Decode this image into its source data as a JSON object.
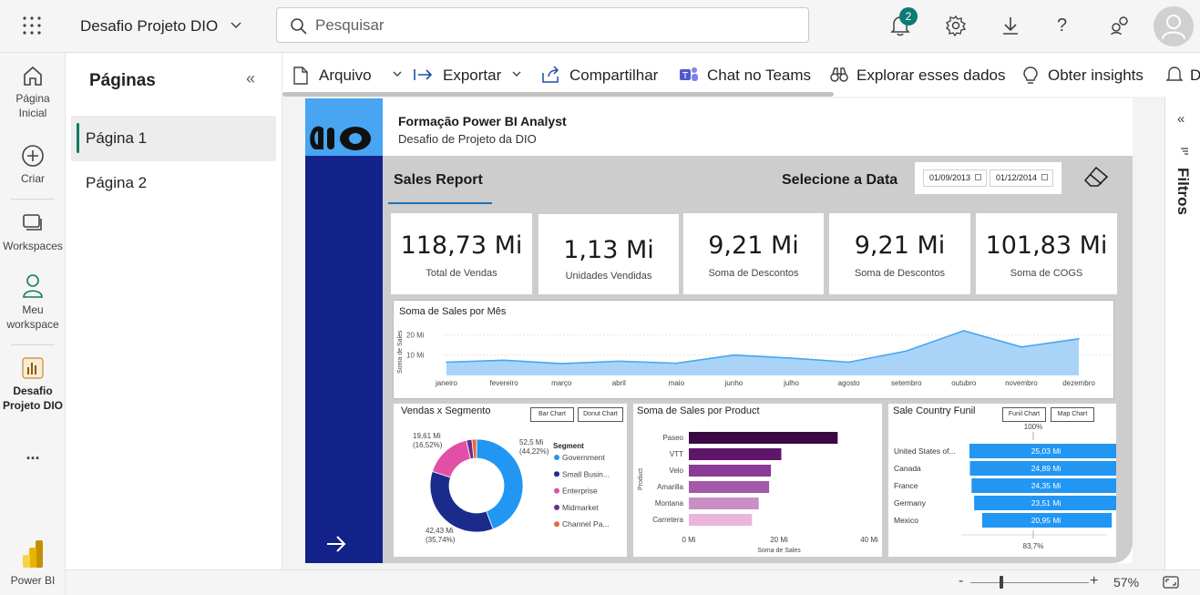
{
  "topbar": {
    "workspace_title": "Desafio Projeto DIO",
    "search_placeholder": "Pesquisar",
    "notification_count": "2"
  },
  "rail": {
    "items": [
      {
        "label": "Página Inicial"
      },
      {
        "label": "Criar"
      },
      {
        "label": "Workspaces"
      },
      {
        "label": "Meu workspace"
      },
      {
        "label": "Desafio Projeto DIO"
      },
      {
        "label": "..."
      }
    ],
    "brand": "Power BI"
  },
  "pages_pane": {
    "title": "Páginas",
    "pages": [
      "Página 1",
      "Página 2"
    ],
    "active": "Página 1"
  },
  "commands": {
    "arquivo": "Arquivo",
    "exportar": "Exportar",
    "compartilhar": "Compartilhar",
    "teams": "Chat no Teams",
    "explorar": "Explorar esses dados",
    "insights": "Obter insights",
    "cut": "D"
  },
  "report": {
    "title": "Formação Power BI Analyst",
    "subtitle": "Desafio de Projeto da DIO",
    "section": "Sales Report",
    "date_label": "Selecione a Data",
    "date_start": "01/09/2013",
    "date_end": "01/12/2014",
    "kpis": [
      {
        "value": "118,73 Mi",
        "label": "Total de Vendas"
      },
      {
        "value": "1,13 Mi",
        "label": "Unidades Vendidas"
      },
      {
        "value": "9,21 Mi",
        "label": "Soma de Descontos"
      },
      {
        "value": "9,21 Mi",
        "label": "Soma de Descontos"
      },
      {
        "value": "101,83 Mi",
        "label": "Soma de COGS"
      }
    ],
    "visual_titles": {
      "line": "Soma de Sales por Mês",
      "donut": "Vendas x Segmento",
      "bar": "Soma de Sales por Product",
      "funnel": "Sale Country Funil"
    },
    "buttons": {
      "bar_chart": "Bar Chart",
      "donut_chart": "Donut Chart",
      "funil_chart": "Funil Chart",
      "map_chart": "Map Chart"
    }
  },
  "chart_data": [
    {
      "type": "area",
      "title": "Soma de Sales por Mês",
      "ylabel": "Soma de Sales",
      "xlabel": "",
      "categories": [
        "janeiro",
        "fevereiro",
        "março",
        "abril",
        "maio",
        "junho",
        "julho",
        "agosto",
        "setembro",
        "outubro",
        "novembro",
        "dezembro"
      ],
      "values": [
        6.5,
        7.5,
        5.8,
        7.0,
        6.0,
        10.0,
        8.5,
        6.5,
        12.0,
        22.0,
        14.0,
        18.0
      ],
      "yticks": [
        "10 Mi",
        "20 Mi"
      ],
      "ytick_values": [
        10,
        20
      ],
      "ylim": [
        0,
        26
      ],
      "color": "#47a5f2"
    },
    {
      "type": "pie",
      "title": "Vendas x Segmento",
      "legend_title": "Segment",
      "categories": [
        "Government",
        "Small Busin...",
        "Enterprise",
        "Midmarket",
        "Channel Pa..."
      ],
      "values": [
        52.5,
        42.43,
        19.61,
        2.3,
        1.9
      ],
      "data_labels": [
        {
          "value": "52,5 Mi",
          "pct": "(44,22%)"
        },
        {
          "value": "42,43 Mi",
          "pct": "(35,74%)"
        },
        {
          "value": "19,61 Mi",
          "pct": "(16,52%)"
        }
      ],
      "colors": [
        "#2196f3",
        "#1a2b8c",
        "#e34fa6",
        "#6e2b8f",
        "#e86a3a"
      ],
      "legend_position": "right"
    },
    {
      "type": "bar",
      "title": "Soma de Sales por Product",
      "xlabel": "Soma de Sales",
      "ylabel": "Product",
      "categories": [
        "Paseo",
        "VTT",
        "Velo",
        "Amarilla",
        "Montana",
        "Carretera"
      ],
      "values": [
        33,
        20.5,
        18.2,
        17.8,
        15.5,
        14.0
      ],
      "xticks": [
        "0 Mi",
        "20 Mi",
        "40 Mi"
      ],
      "xtick_values": [
        0,
        20,
        40
      ],
      "xlim": [
        0,
        40
      ],
      "colors": [
        "#3b0a45",
        "#5e1669",
        "#8b3a95",
        "#a45aa9",
        "#c98fc5",
        "#e9b5dd"
      ]
    },
    {
      "type": "bar",
      "title": "Sale Country Funil",
      "categories": [
        "United States of...",
        "Canada",
        "France",
        "Germany",
        "Mexico"
      ],
      "values": [
        25.03,
        24.89,
        24.35,
        23.51,
        20.95
      ],
      "data_labels": [
        "25,03 Mi",
        "24,89 Mi",
        "24,35 Mi",
        "23,51 Mi",
        "20,95 Mi"
      ],
      "top_label": "100%",
      "bottom_label": "83,7%",
      "color": "#2196f3"
    }
  ],
  "status": {
    "zoom": "57%",
    "zoom_level": 0.57
  },
  "filters": {
    "label": "Filtros"
  },
  "colors": {
    "accent": "#117865",
    "report_sidebar": "#12228a",
    "logo_bg": "#47a5f2",
    "panel_gray": "#cdcdcd"
  }
}
